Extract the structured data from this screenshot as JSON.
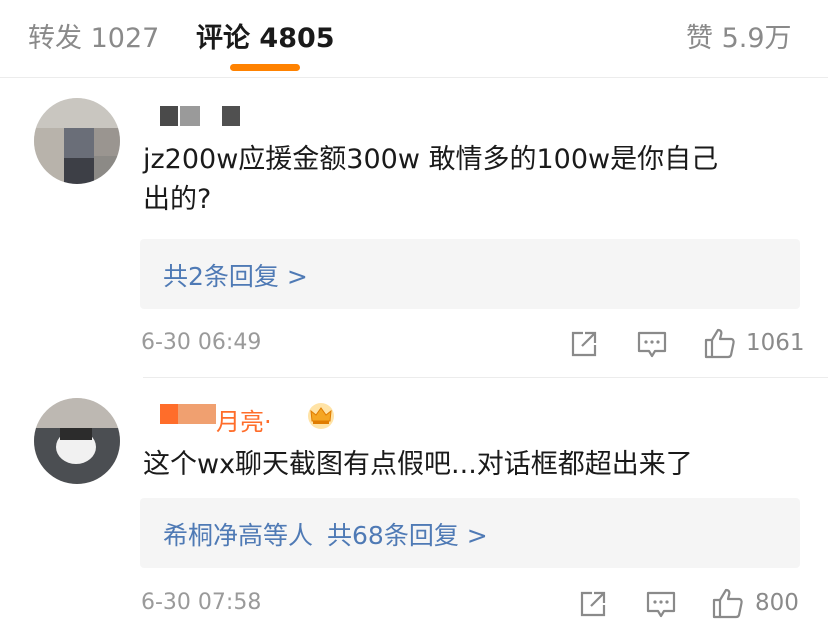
{
  "tabs": [
    {
      "label": "转发",
      "count": "1027"
    },
    {
      "label": "评论",
      "count": "4805"
    },
    {
      "label": "赞",
      "count": "5.9万"
    }
  ],
  "comments": [
    {
      "username_visible": "",
      "text_line1": "jz200w应援金额300w 敢情多的100w是你自己",
      "text_line2": "出的?",
      "reply_summary": "共2条回复 >",
      "time": "6-30 06:49",
      "likes": "1061"
    },
    {
      "username_visible": "月亮·",
      "text_line1": "这个wx聊天截图有点假吧...对话框都超出来了",
      "reply_names": "希桐净高等人",
      "reply_summary": "共68条回复 >",
      "time": "6-30 07:58",
      "likes": "800"
    }
  ],
  "colors": {
    "accent": "#ff8200",
    "link": "#4f7ab5",
    "crown": "#f5a623"
  },
  "icons": [
    "share-icon",
    "comment-icon",
    "like-icon",
    "crown-icon"
  ]
}
